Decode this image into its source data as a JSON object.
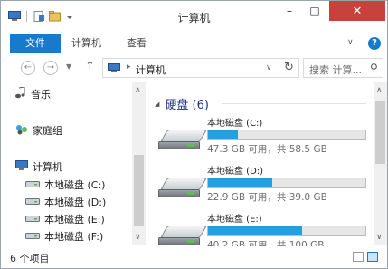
{
  "window": {
    "title": "计算机"
  },
  "title_buttons": {
    "minimize": "–",
    "maximize": "□",
    "close": "✕"
  },
  "ribbon": {
    "tabs": [
      {
        "label": "文件",
        "active": true
      },
      {
        "label": "计算机",
        "active": false
      },
      {
        "label": "查看",
        "active": false
      }
    ],
    "accent_color": "#1979ca"
  },
  "address": {
    "back_glyph": "←",
    "forward_glyph": "→",
    "up_glyph": "↑",
    "crumb": "计算机",
    "search_placeholder": "搜索 计算..."
  },
  "nav": {
    "items": [
      {
        "label": "音乐",
        "icon": "music-icon"
      },
      {
        "label": "家庭组",
        "icon": "homegroup-icon"
      },
      {
        "label": "计算机",
        "icon": "computer-icon"
      },
      {
        "label": "本地磁盘 (C:)",
        "icon": "drive-icon"
      },
      {
        "label": "本地磁盘 (D:)",
        "icon": "drive-icon"
      },
      {
        "label": "本地磁盘 (E:)",
        "icon": "drive-icon"
      },
      {
        "label": "本地磁盘 (F:)",
        "icon": "drive-icon"
      }
    ]
  },
  "content": {
    "group_title": "硬盘 (6)",
    "disks": [
      {
        "name": "本地磁盘 (C:)",
        "info": "47.3 GB 可用，共 58.5 GB",
        "used_fraction": 0.19
      },
      {
        "name": "本地磁盘 (D:)",
        "info": "22.9 GB 可用，共 39.0 GB",
        "used_fraction": 0.41
      },
      {
        "name": "本地磁盘 (E:)",
        "info": "40.2 GB 可用，共 100 GB",
        "used_fraction": 0.6
      }
    ],
    "bar_color": "#26a0da"
  },
  "status": {
    "item_count": "6 个项目"
  }
}
